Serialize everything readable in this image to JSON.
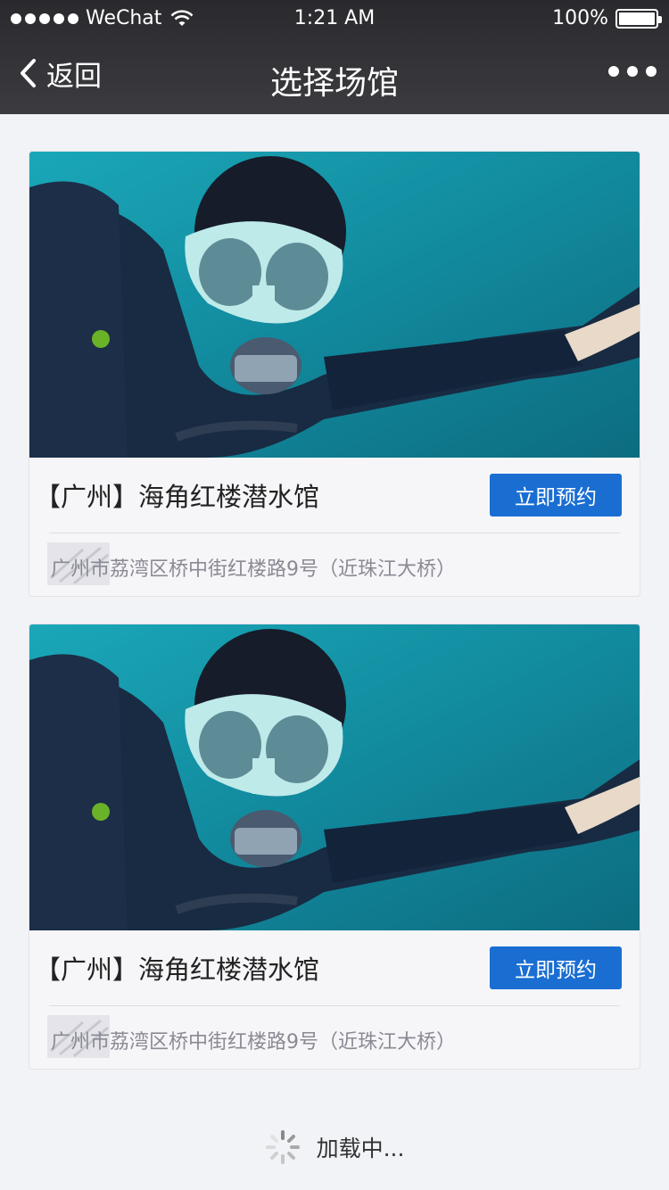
{
  "status_bar": {
    "carrier": "WeChat",
    "time": "1:21 AM",
    "battery": "100%"
  },
  "nav": {
    "back_label": "返回",
    "title": "选择场馆",
    "more_icon": "more-dots-icon"
  },
  "venues": [
    {
      "name": "【广州】海角红楼潜水馆",
      "book_label": "立即预约",
      "address": "广州市荔湾区桥中街红楼路9号（近珠江大桥）"
    },
    {
      "name": "【广州】海角红楼潜水馆",
      "book_label": "立即预约",
      "address": "广州市荔湾区桥中街红楼路9号（近珠江大桥）"
    }
  ],
  "loading": {
    "text": "加载中..."
  },
  "colors": {
    "nav_bg": "#2f2f33",
    "button": "#1a6ed2",
    "page_bg": "#f2f3f7"
  }
}
